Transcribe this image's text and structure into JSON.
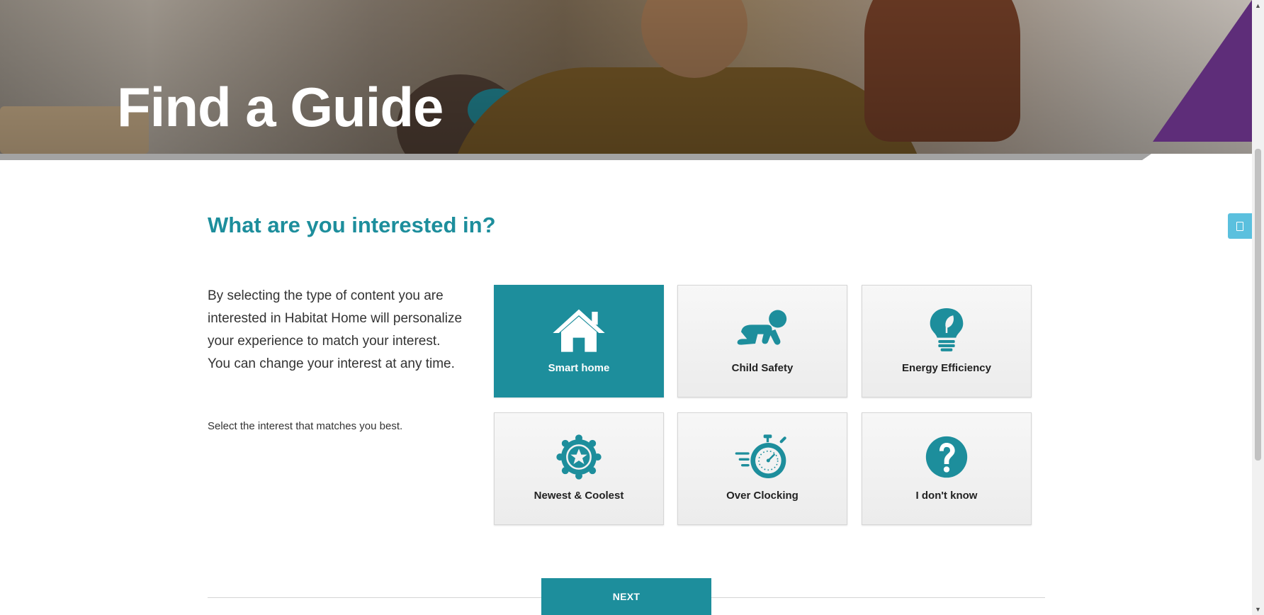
{
  "hero": {
    "title": "Find a Guide"
  },
  "main": {
    "section_title": "What are you interested in?",
    "description": "By selecting the type of content you are interested in Habitat Home will personalize your experience to match your interest. You can change your interest at any time.",
    "hint": "Select the interest that matches you best.",
    "tiles": [
      {
        "label": "Smart home",
        "icon": "house-icon",
        "selected": true
      },
      {
        "label": "Child Safety",
        "icon": "crawling-baby-icon",
        "selected": false
      },
      {
        "label": "Energy Efficiency",
        "icon": "leaf-lightbulb-icon",
        "selected": false
      },
      {
        "label": "Newest & Coolest",
        "icon": "star-badge-icon",
        "selected": false
      },
      {
        "label": "Over Clocking",
        "icon": "stopwatch-speed-icon",
        "selected": false
      },
      {
        "label": "I don't know",
        "icon": "question-mark-icon",
        "selected": false
      }
    ],
    "next_label": "NEXT"
  },
  "colors": {
    "accent": "#1d8e9c",
    "purple": "#5e2d79",
    "side_tab": "#5bc0de"
  }
}
